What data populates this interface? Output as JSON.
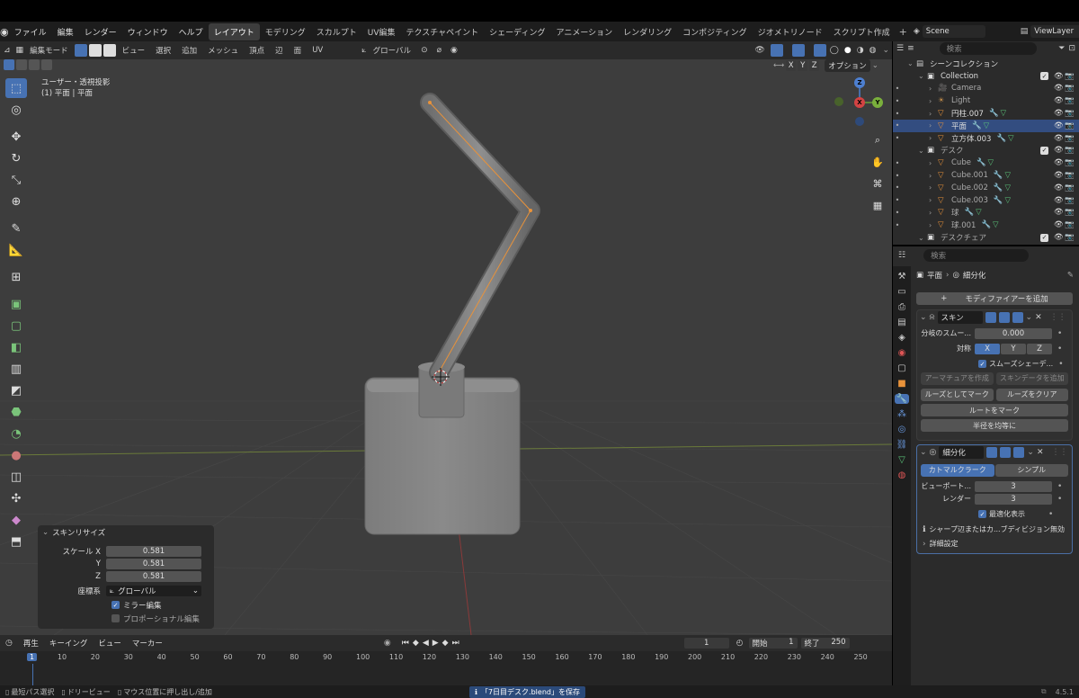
{
  "menubar": {
    "items": [
      "ファイル",
      "編集",
      "レンダー",
      "ウィンドウ",
      "ヘルプ"
    ],
    "workspaces": [
      "レイアウト",
      "モデリング",
      "スカルプト",
      "UV編集",
      "テクスチャペイント",
      "シェーディング",
      "アニメーション",
      "レンダリング",
      "コンポジティング",
      "ジオメトリノード",
      "スクリプト作成"
    ],
    "active_workspace": "レイアウト",
    "scene": "Scene",
    "view_layer": "ViewLayer"
  },
  "viewport": {
    "mode": "編集モード",
    "menus": [
      "ビュー",
      "選択",
      "追加",
      "メッシュ",
      "頂点",
      "辺",
      "面",
      "UV"
    ],
    "transform_orientation": "グローバル",
    "options_label": "オプション",
    "axes": [
      "X",
      "Y",
      "Z"
    ],
    "info_line1": "ユーザー・透視投影",
    "info_line2": "(1) 平面 | 平面",
    "gizmo": {
      "x": "X",
      "y": "Y",
      "z": "Z"
    }
  },
  "operator_panel": {
    "title": "スキンリサイズ",
    "scale_label": "スケール X",
    "y_label": "Y",
    "z_label": "Z",
    "scale_x": "0.581",
    "scale_y": "0.581",
    "scale_z": "0.581",
    "orient_label": "座標系",
    "orient_value": "グローバル",
    "mirror_label": "ミラー編集",
    "mirror_checked": true,
    "proportional_label": "プロポーショナル編集",
    "proportional_checked": false
  },
  "outliner": {
    "search_placeholder": "検索",
    "rows": [
      {
        "label": "シーンコレクション",
        "indent": 0,
        "type": "scene"
      },
      {
        "label": "Collection",
        "indent": 1,
        "type": "collection"
      },
      {
        "label": "Camera",
        "indent": 2,
        "type": "camera",
        "dim": true
      },
      {
        "label": "Light",
        "indent": 2,
        "type": "light",
        "dim": true
      },
      {
        "label": "円柱.007",
        "indent": 2,
        "type": "mesh"
      },
      {
        "label": "平面",
        "indent": 2,
        "type": "mesh",
        "selected": true
      },
      {
        "label": "立方体.003",
        "indent": 2,
        "type": "mesh"
      },
      {
        "label": "デスク",
        "indent": 1,
        "type": "collection",
        "dim": true
      },
      {
        "label": "Cube",
        "indent": 2,
        "type": "mesh",
        "dim": true
      },
      {
        "label": "Cube.001",
        "indent": 2,
        "type": "mesh",
        "dim": true
      },
      {
        "label": "Cube.002",
        "indent": 2,
        "type": "mesh",
        "dim": true
      },
      {
        "label": "Cube.003",
        "indent": 2,
        "type": "mesh",
        "dim": true
      },
      {
        "label": "球",
        "indent": 2,
        "type": "mesh",
        "dim": true
      },
      {
        "label": "球.001",
        "indent": 2,
        "type": "mesh",
        "dim": true
      },
      {
        "label": "デスクチェア",
        "indent": 1,
        "type": "collection",
        "dim": true
      }
    ]
  },
  "properties": {
    "search_placeholder": "検索",
    "breadcrumb_object": "平面",
    "breadcrumb_modifier": "細分化",
    "add_modifier": "モディファイアーを追加",
    "skin": {
      "name": "スキン",
      "branch_smoothing_label": "分岐のスムー...",
      "branch_smoothing_value": "0.000",
      "symmetry_label": "対称",
      "axes": [
        "X",
        "Y",
        "Z"
      ],
      "smooth_shading_label": "スムーズシェーデ...",
      "create_armature": "アーマチュアを作成",
      "add_skin_data": "スキンデータを追加",
      "mark_loose": "ルーズとしてマーク",
      "clear_loose": "ルーズをクリア",
      "mark_root": "ルートをマーク",
      "equalize_radii": "半径を均等に"
    },
    "subsurf": {
      "name": "細分化",
      "catmull": "カトマルクラーク",
      "simple": "シンプル",
      "viewport_label": "ビューポート...",
      "viewport_value": "3",
      "render_label": "レンダー",
      "render_value": "3",
      "optimal_label": "最適化表示",
      "warning": "シャープ辺またはカ...ブディビジョン無効",
      "advanced": "詳細設定"
    }
  },
  "timeline": {
    "menus": [
      "再生",
      "キーイング",
      "ビュー",
      "マーカー"
    ],
    "current_frame": "1",
    "start_label": "開始",
    "start": "1",
    "end_label": "終了",
    "end": "250",
    "ticks": [
      "1",
      "10",
      "20",
      "30",
      "40",
      "50",
      "60",
      "70",
      "80",
      "90",
      "100",
      "110",
      "120",
      "130",
      "140",
      "150",
      "160",
      "170",
      "180",
      "190",
      "200",
      "210",
      "220",
      "230",
      "240",
      "250"
    ]
  },
  "status": {
    "left1": "最短パス選択",
    "left2": "ドリービュー",
    "left3": "マウス位置に押し出し/追加",
    "message": "「7日目デスク.blend」を保存",
    "version": "4.5.1"
  },
  "colors": {
    "accent": "#4772b3",
    "select": "#334d80",
    "edit_orange": "#e8923a",
    "grid_x": "#8a3a3a",
    "grid_y": "#6a8a3a"
  }
}
